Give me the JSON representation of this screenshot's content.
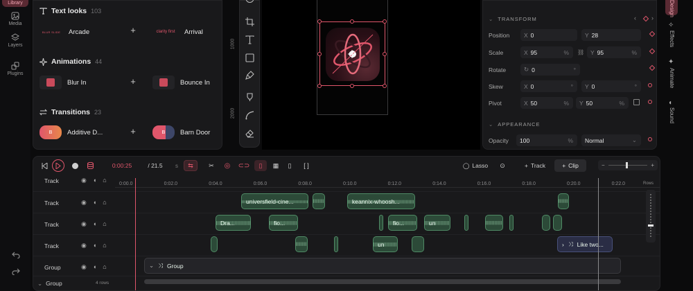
{
  "rail": {
    "library": "Library",
    "media": "Media",
    "layers": "Layers",
    "plugins": "Plugins"
  },
  "library": {
    "text_looks": {
      "title": "Text looks",
      "count": "103",
      "items": [
        {
          "thumb": "BLUR SLIDE",
          "label": "Arcade"
        },
        {
          "thumb": "clarity first",
          "label": "Arrival"
        }
      ]
    },
    "animations": {
      "title": "Animations",
      "count": "44",
      "items": [
        {
          "label": "Blur In"
        },
        {
          "label": "Bounce In"
        }
      ]
    },
    "transitions": {
      "title": "Transitions",
      "count": "23",
      "items": [
        {
          "thumb": "B",
          "label": "Additive D..."
        },
        {
          "thumb": "B",
          "label": "Barn Door"
        }
      ]
    }
  },
  "canvas": {
    "ruler_a": "1000",
    "ruler_b": "2000"
  },
  "props": {
    "transform": "TRANSFORM",
    "appearance": "APPEARANCE",
    "position": {
      "label": "Position",
      "x": "0",
      "y": "28"
    },
    "scale": {
      "label": "Scale",
      "x": "95",
      "y": "95",
      "unit": "%"
    },
    "rotate": {
      "label": "Rotate",
      "v": "0",
      "unit": "°"
    },
    "skew": {
      "label": "Skew",
      "x": "0",
      "y": "0",
      "unit": "°"
    },
    "pivot": {
      "label": "Pivot",
      "x": "50",
      "y": "50",
      "unit": "%"
    },
    "opacity": {
      "label": "Opacity",
      "v": "100",
      "unit": "%",
      "blend": "Normal"
    }
  },
  "side_tabs": {
    "design": "Design",
    "effects": "Effects",
    "animate": "Animate",
    "sound": "Sound"
  },
  "timeline": {
    "time": "0:00:25",
    "frames": "/ 21.5",
    "fps": "s",
    "lasso": "Lasso",
    "add_track": "Track",
    "add_clip": "Clip",
    "rows": "Rows",
    "ticks": [
      "0:00.0",
      "0:02.0",
      "0:04.0",
      "0:06.0",
      "0:08.0",
      "0:10.0",
      "0:12.0",
      "0:14.0",
      "0:16.0",
      "0:18.0",
      "0:20.0",
      "0:22.0"
    ],
    "lanes": [
      "Track",
      "Track",
      "Track",
      "Track",
      "Group"
    ],
    "group_row": "Group",
    "group_rows": "4 rows",
    "clips": {
      "universfield": "universfield-cine...",
      "keannix": "keannix-whoosh...",
      "dra": "Dra...",
      "fio1": "fio...",
      "fio2": "fio...",
      "un1": "un",
      "un2": "un",
      "like": "Like two...",
      "group": "Group"
    }
  },
  "colors": {
    "accent": "#e0566b",
    "clip_green": "#2c4a38"
  }
}
